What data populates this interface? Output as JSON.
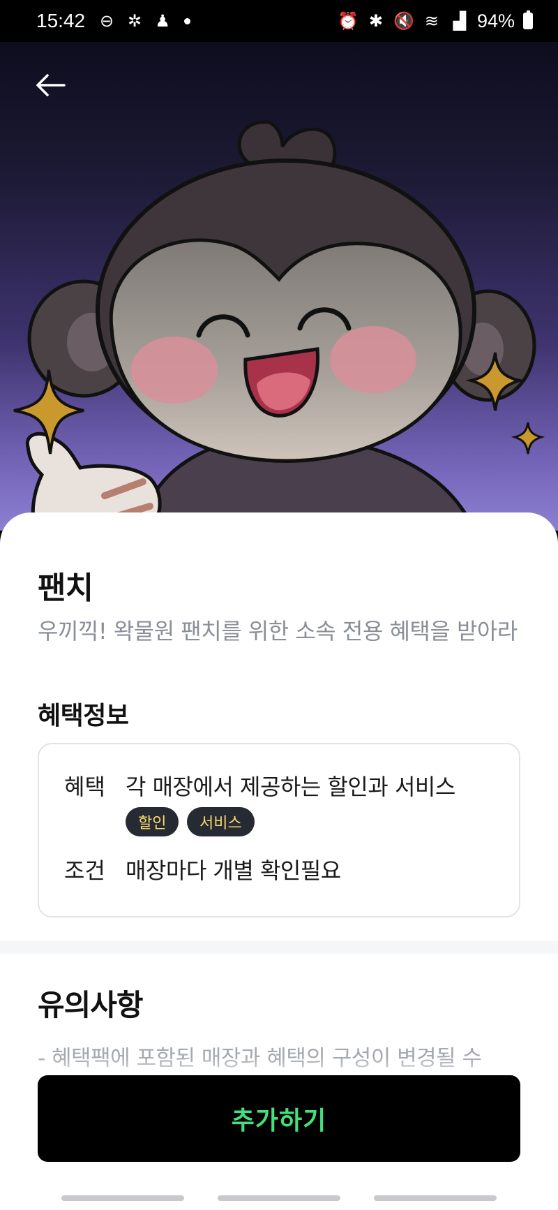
{
  "status_bar": {
    "time": "15:42",
    "battery": "94%",
    "left_icons": [
      "do-not-disturb-icon",
      "network-icon",
      "assistant-icon"
    ],
    "right_icons": [
      "alarm-icon",
      "bluetooth-icon",
      "mute-icon",
      "wifi-icon",
      "signal-icon",
      "battery-icon"
    ]
  },
  "header": {
    "back_icon": "arrow-left-icon"
  },
  "pack": {
    "title": "팬치",
    "description": "우끼끽! 왁물원 팬치를 위한 소속 전용 혜택을 받아라"
  },
  "benefit_info": {
    "section_title": "혜택정보",
    "benefit_label": "혜택",
    "benefit_value": "각 매장에서 제공하는 할인과 서비스",
    "tags": [
      "할인",
      "서비스"
    ],
    "condition_label": "조건",
    "condition_value": "매장마다 개별 확인필요"
  },
  "notice": {
    "title": "유의사항",
    "first_line": "- 혜택팩에 포함된 매장과 혜택의 구성이 변경될 수"
  },
  "cta": {
    "label": "추가하기"
  },
  "colors": {
    "cta_background": "#000000",
    "cta_text": "#43e07c",
    "tag_background": "#262a33",
    "tag_text": "#f6d96a"
  }
}
